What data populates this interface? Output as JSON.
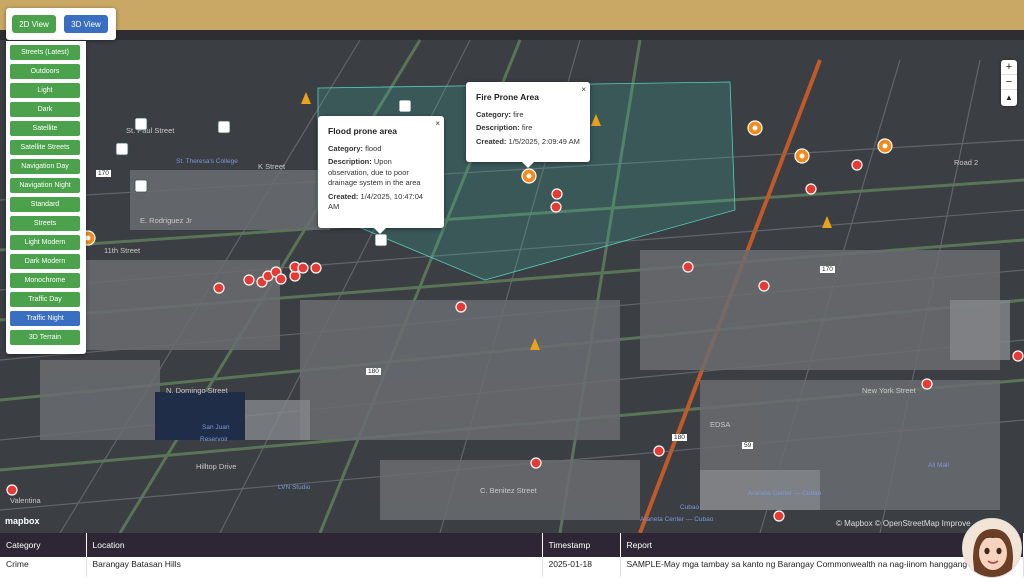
{
  "view_toggle": {
    "btn_2d": "2D View",
    "btn_3d": "3D View"
  },
  "map_styles": [
    "Streets (Latest)",
    "Outdoors",
    "Light",
    "Dark",
    "Satellite",
    "Satellite Streets",
    "Navigation Day",
    "Navigation Night",
    "Standard",
    "Streets",
    "Light Modern",
    "Dark Modern",
    "Monochrome",
    "Traffic Day",
    "Traffic Night",
    "3D Terrain"
  ],
  "active_style": "Traffic Night",
  "zoom": {
    "in": "+",
    "out": "−",
    "compass": "▲"
  },
  "popups": [
    {
      "title": "Flood prone area",
      "category_label": "Category:",
      "category": "flood",
      "description_label": "Description:",
      "description": "Upon observation, due to poor drainage system in the area",
      "created_label": "Created:",
      "created": "1/4/2025, 10:47:04 AM",
      "close": "×"
    },
    {
      "title": "Fire Prone Area",
      "category_label": "Category:",
      "category": "fire",
      "description_label": "Description:",
      "description": "fire",
      "created_label": "Created:",
      "created": "1/5/2025, 2:09:49 AM",
      "close": "×"
    }
  ],
  "map_labels": {
    "n_domingo": "N. Domingo Street",
    "san_juan": "San Juan",
    "reservoir": "Reservoir",
    "hilltop": "Hilltop Drive",
    "lvn": "LVN Studio",
    "benitez": "C. Benitez Street",
    "araneta": "Araneta Center — Cubao",
    "araneta2": "Araneta Center — Cubao",
    "ali_mall": "Ali Mall",
    "edsa": "EDSA",
    "new_york": "New York Street",
    "valentina": "Valentina",
    "cubao": "Cubao",
    "street_11th": "11th Street",
    "e_rodriguez": "E. Rodriguez Jr",
    "k_street": "K Street",
    "road_2": "Road 2",
    "st_paul": "St. Paul Street",
    "college": "St. Theresa's College"
  },
  "road_numbers": [
    "180",
    "180",
    "59",
    "170",
    "170"
  ],
  "attribution": "© Mapbox © OpenStreetMap Improve",
  "mapbox_logo": "mapbox",
  "table": {
    "headers": [
      "Category",
      "Location",
      "Timestamp",
      "Report"
    ],
    "rows": [
      [
        "Crime",
        "Barangay Batasan Hills",
        "2025-01-18",
        "SAMPLE-May mga tambay sa kanto ng Barangay Commonwealth na nag-iinom hanggang"
      ]
    ]
  },
  "colors": {
    "green_btn": "#4ca14c",
    "blue_btn": "#3a6ec0",
    "marker_red": "#e53b34",
    "marker_orange": "#f28a1c",
    "header_bg": "#2e2634"
  }
}
